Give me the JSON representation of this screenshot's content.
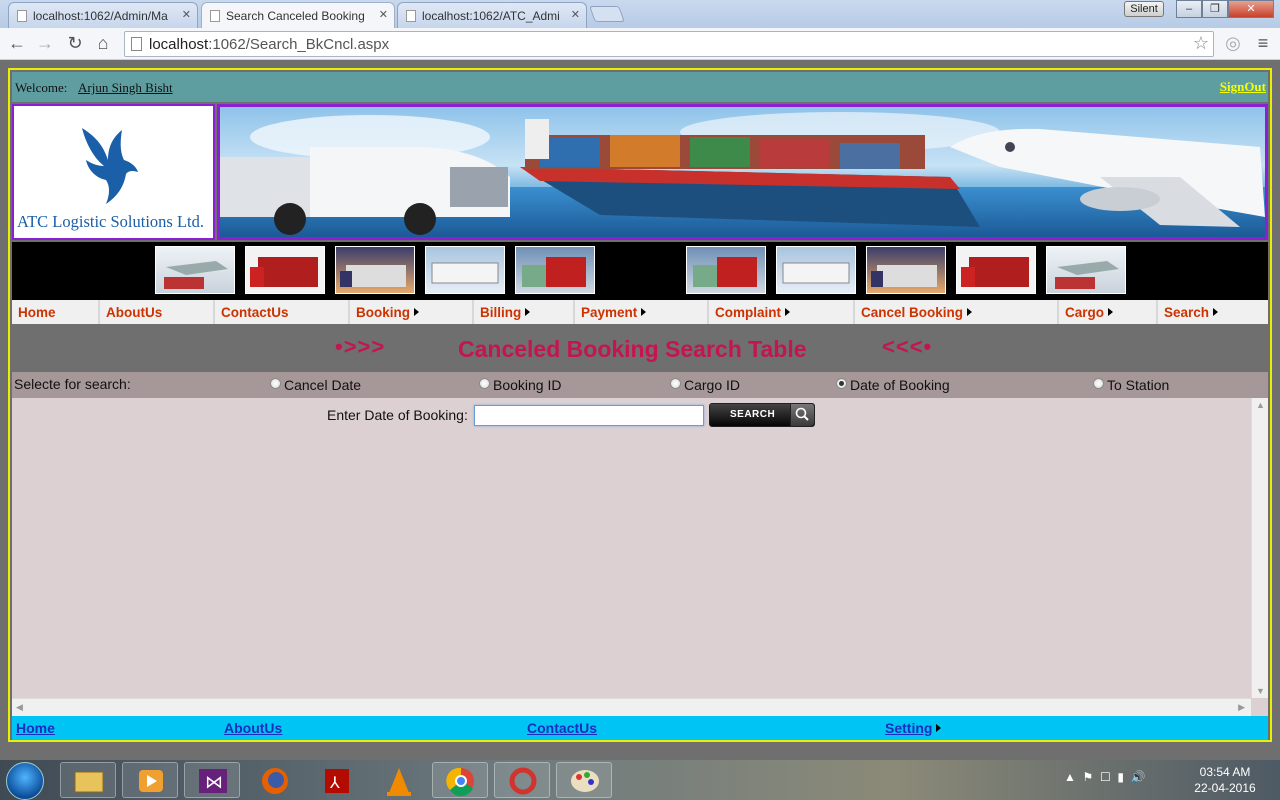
{
  "browser": {
    "tabs": [
      {
        "title": "localhost:1062/Admin/Ma",
        "active": false
      },
      {
        "title": "Search Canceled Booking",
        "active": true
      },
      {
        "title": "localhost:1062/ATC_Admi",
        "active": false
      }
    ],
    "profile_label": "Silent",
    "url_host": "localhost",
    "url_rest": ":1062/Search_BkCncl.aspx"
  },
  "header": {
    "welcome_label": "Welcome:",
    "user_name": "Arjun Singh Bisht",
    "signout": "SignOut",
    "logo_text": "ATC Logistic Solutions Ltd.",
    "brand_colors": {
      "logo_text": "#1a5fa8",
      "border": "#8b1fd3"
    }
  },
  "menu": [
    {
      "label": "Home",
      "submenu": false
    },
    {
      "label": "AboutUs",
      "submenu": false
    },
    {
      "label": "ContactUs",
      "submenu": false
    },
    {
      "label": "Booking",
      "submenu": true
    },
    {
      "label": "Billing",
      "submenu": true
    },
    {
      "label": "Payment",
      "submenu": true
    },
    {
      "label": "Complaint",
      "submenu": true
    },
    {
      "label": "Cancel Booking",
      "submenu": true
    },
    {
      "label": "Cargo",
      "submenu": true
    },
    {
      "label": "Search",
      "submenu": true
    }
  ],
  "title_bar": {
    "left_decor": "•>>>",
    "title": "Canceled Booking Search Table",
    "right_decor": "<<<•"
  },
  "search": {
    "prompt": "Selecte for search:",
    "options": [
      {
        "label": "Cancel Date",
        "selected": false
      },
      {
        "label": "Booking ID",
        "selected": false
      },
      {
        "label": "Cargo ID",
        "selected": false
      },
      {
        "label": "Date of Booking",
        "selected": true
      },
      {
        "label": "To Station",
        "selected": false
      }
    ],
    "field_label": "Enter Date of Booking:",
    "field_value": "",
    "button_label": "SEARCH"
  },
  "footer": [
    {
      "label": "Home",
      "submenu": false
    },
    {
      "label": "AboutUs",
      "submenu": false
    },
    {
      "label": "ContactUs",
      "submenu": false
    },
    {
      "label": "Setting",
      "submenu": true
    }
  ],
  "taskbar": {
    "apps": [
      "file-explorer",
      "media-player",
      "visual-studio",
      "firefox",
      "acrobat",
      "vlc",
      "chrome",
      "ccleaner",
      "paint"
    ],
    "time": "03:54 AM",
    "date": "22-04-2016"
  }
}
